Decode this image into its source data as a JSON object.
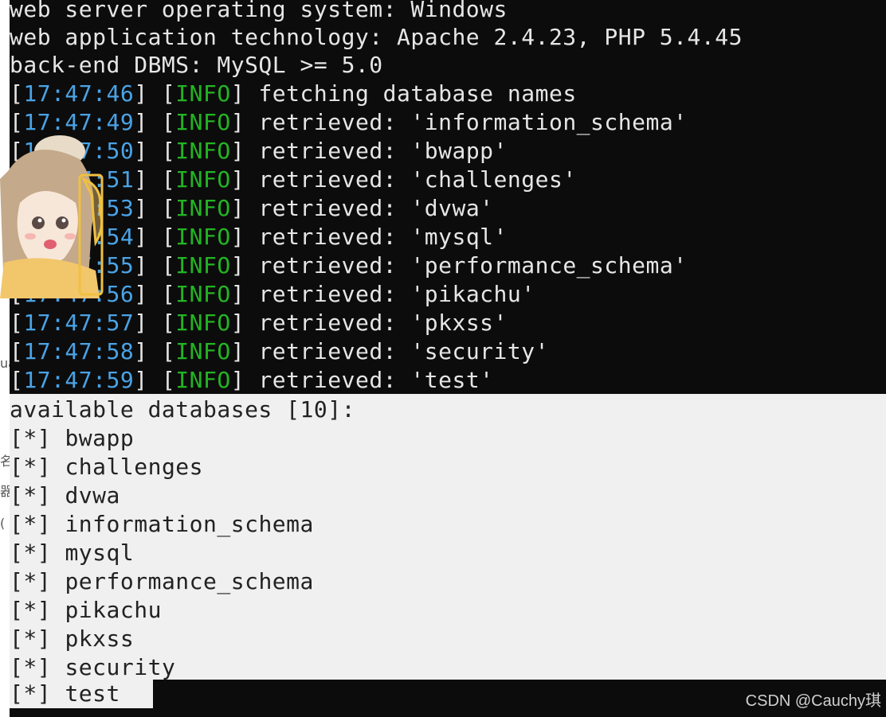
{
  "terminal": {
    "header_lines": [
      "web server operating system: Windows",
      "web application technology: Apache 2.4.23, PHP 5.4.45",
      "back-end DBMS: MySQL >= 5.0"
    ],
    "log_lines": [
      {
        "time": "17:47:46",
        "level": "INFO",
        "message": "fetching database names"
      },
      {
        "time": "17:47:49",
        "level": "INFO",
        "message": "retrieved: 'information_schema'"
      },
      {
        "time": "17:47:50",
        "level": "INFO",
        "message": "retrieved: 'bwapp'"
      },
      {
        "time": "17:47:51",
        "level": "INFO",
        "message": "retrieved: 'challenges'"
      },
      {
        "time": "17:47:53",
        "level": "INFO",
        "message": "retrieved: 'dvwa'"
      },
      {
        "time": "17:47:54",
        "level": "INFO",
        "message": "retrieved: 'mysql'"
      },
      {
        "time": "17:47:55",
        "level": "INFO",
        "message": "retrieved: 'performance_schema'"
      },
      {
        "time": "17:47:56",
        "level": "INFO",
        "message": "retrieved: 'pikachu'"
      },
      {
        "time": "17:47:57",
        "level": "INFO",
        "message": "retrieved: 'pkxss'"
      },
      {
        "time": "17:47:58",
        "level": "INFO",
        "message": "retrieved: 'security'"
      },
      {
        "time": "17:47:59",
        "level": "INFO",
        "message": "retrieved: 'test'"
      }
    ],
    "available_header": "available databases [10]:",
    "bullet": "[*]",
    "databases": [
      "bwapp",
      "challenges",
      "dvwa",
      "information_schema",
      "mysql",
      "performance_schema",
      "pikachu",
      "pkxss",
      "security",
      "test"
    ]
  },
  "left_edge_glyphs": [
    "ua",
    "名",
    "器",
    "("
  ],
  "sticker_icon": "anime-girl-sticker-icon",
  "watermark": "CSDN @Cauchy琪",
  "colors": {
    "terminal_bg": "#0c0c0c",
    "text": "#e6e6e6",
    "timestamp": "#4aa3e6",
    "info": "#23b523",
    "selection_bg": "#f0f0f0"
  }
}
